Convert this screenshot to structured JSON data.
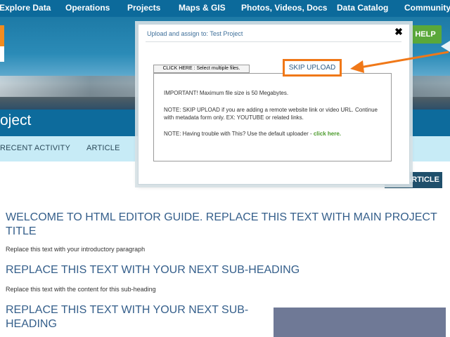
{
  "nav": {
    "items": [
      "Explore Data",
      "Operations",
      "Projects",
      "Maps & GIS",
      "Photos, Videos, Docs",
      "Data Catalog",
      "Community"
    ]
  },
  "header": {
    "help_label": "HELP",
    "project_title": "oject"
  },
  "tabs": [
    "RECENT ACTIVITY",
    "ARTICLE"
  ],
  "add_article_label": "ARTICLE",
  "content": {
    "main_title": "WELCOME TO HTML EDITOR GUIDE. REPLACE THIS TEXT WITH MAIN PROJECT TITLE",
    "intro": "Replace this text with your introductory paragraph",
    "subheading1": "REPLACE THIS TEXT WITH YOUR NEXT SUB-HEADING",
    "sub_text1": "Replace this text with the content for this sub-heading",
    "subheading2": "REPLACE THIS TEXT WITH YOUR NEXT SUB-HEADING"
  },
  "modal": {
    "title": "Upload and assign to: Test Project",
    "close_symbol": "✖",
    "select_files_label": "CLICK HERE : Select multiple files.",
    "skip_upload_label": "SKIP UPLOAD",
    "important": "IMPORTANT! Maximum file size is 50 Megabytes.",
    "note1": "NOTE: SKIP UPLOAD if you are adding a remote website link or video URL. Continue with metadata form only. EX: YOUTUBE or related links.",
    "note2_prefix": "NOTE: Having trouble with This? Use the default uploader - ",
    "note2_link": "click here."
  },
  "colors": {
    "nav_bg": "#0c6a9b",
    "help_green": "#5aa83a",
    "highlight_orange": "#f07818",
    "heading_blue": "#355f8b"
  }
}
